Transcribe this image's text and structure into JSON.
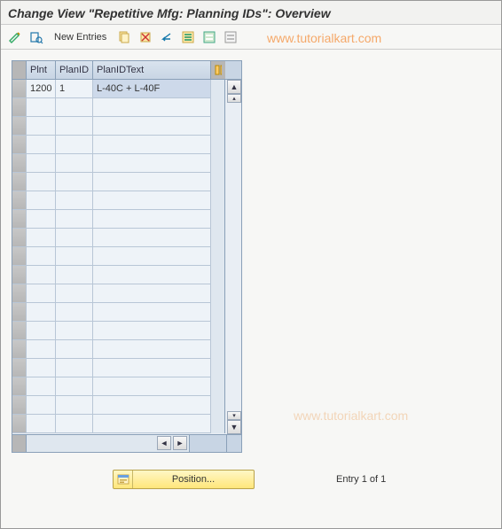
{
  "title": "Change View \"Repetitive Mfg: Planning IDs\": Overview",
  "toolbar": {
    "new_entries": "New Entries"
  },
  "watermark": "www.tutorialkart.com",
  "grid": {
    "columns": {
      "plnt": "Plnt",
      "planid": "PlanID",
      "planidtext": "PlanIDText"
    },
    "rows": [
      {
        "plnt": "1200",
        "planid": "1",
        "planidtext": "L-40C + L-40F"
      }
    ]
  },
  "footer": {
    "position_label": "Position...",
    "entry_text": "Entry 1 of 1"
  }
}
